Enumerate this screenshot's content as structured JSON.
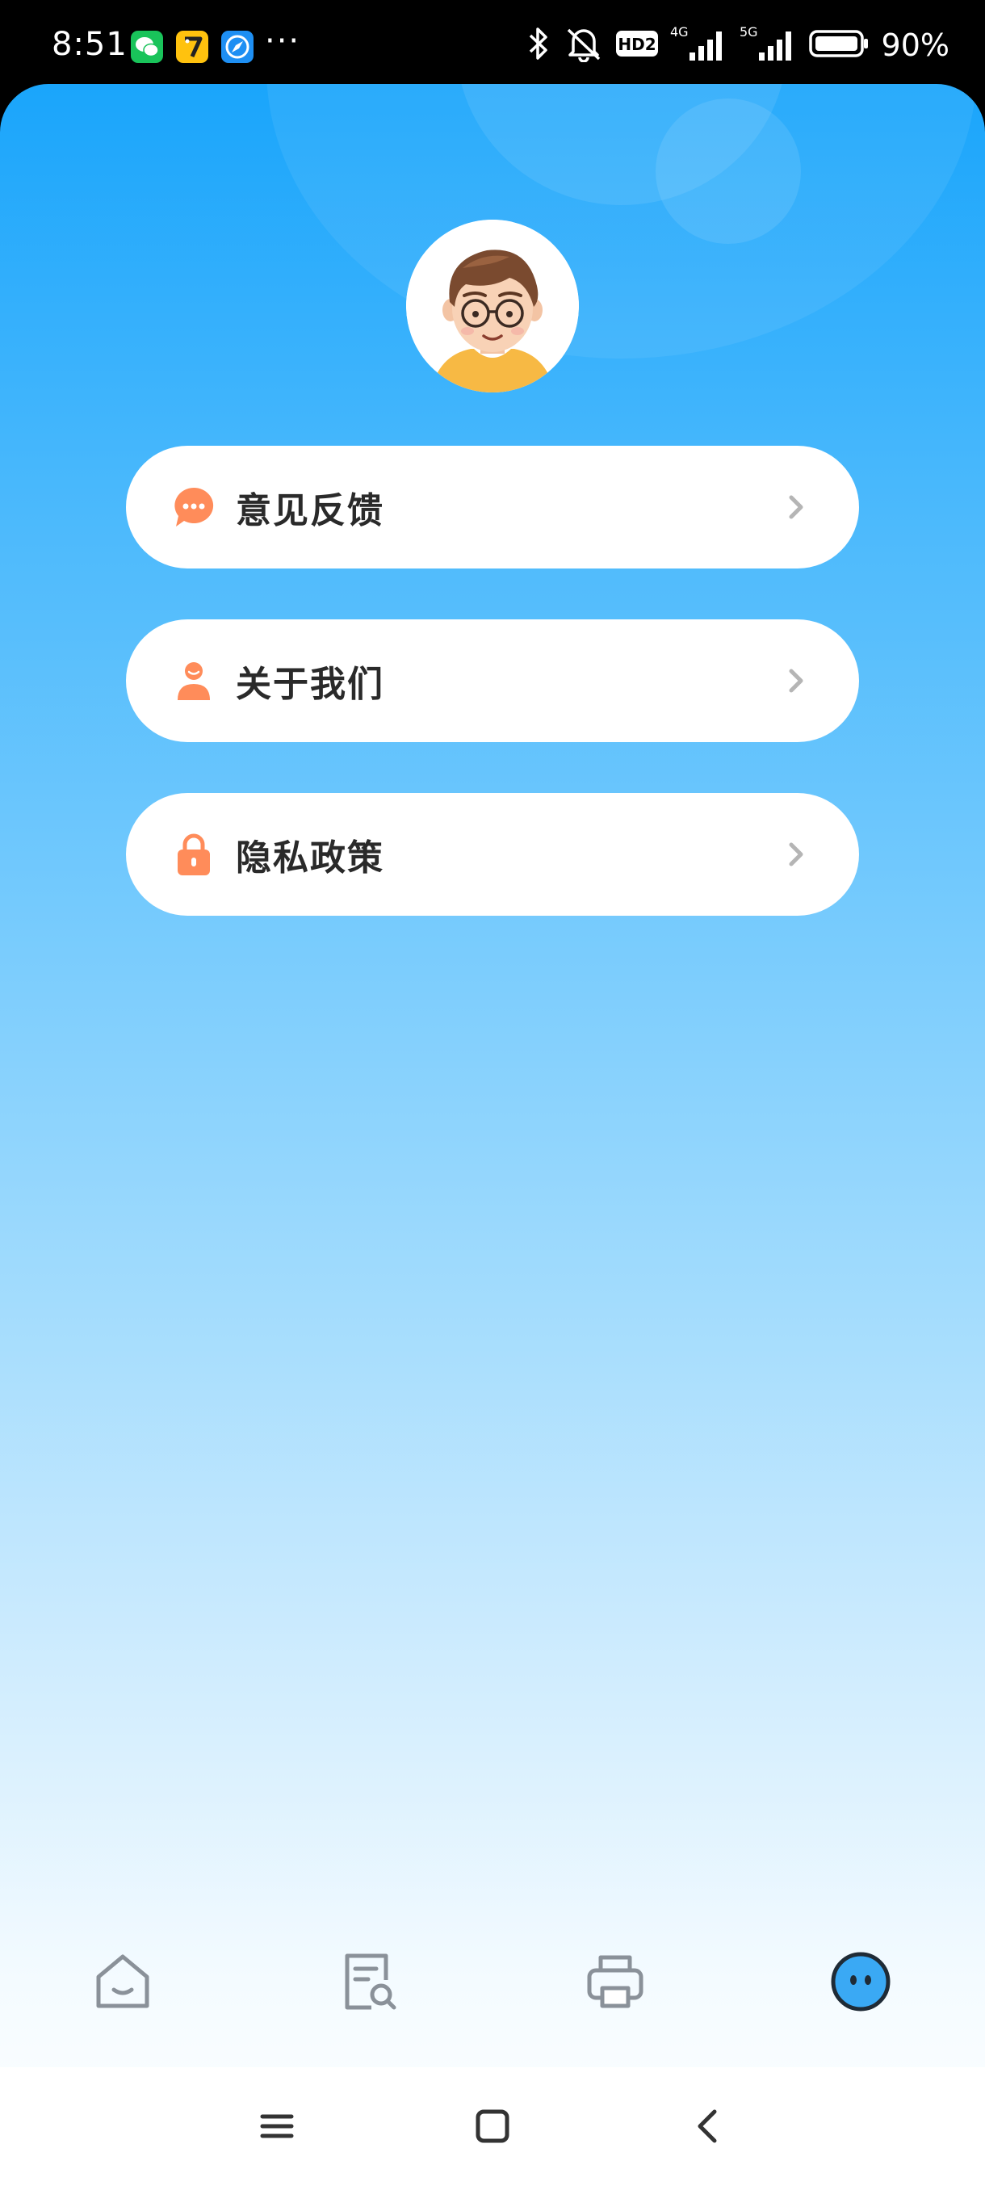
{
  "status_bar": {
    "time": "8:51",
    "more_dots": "···",
    "network_badge": "HD2",
    "signal_1_type": "4G",
    "signal_2_type": "5G",
    "battery": "90%"
  },
  "status_icons": [
    "wechat-icon",
    "seven-app-icon",
    "browser-icon",
    "bluetooth-icon",
    "mute-icon",
    "hd-badge-icon",
    "signal-icon",
    "battery-icon"
  ],
  "menu": {
    "items": [
      {
        "label": "意见反馈",
        "icon": "feedback-icon"
      },
      {
        "label": "关于我们",
        "icon": "about-us-icon"
      },
      {
        "label": "隐私政策",
        "icon": "privacy-lock-icon"
      }
    ]
  },
  "tab_bar": {
    "tabs": [
      {
        "icon": "home-icon"
      },
      {
        "icon": "document-search-icon"
      },
      {
        "icon": "printer-icon"
      },
      {
        "icon": "profile-face-icon",
        "active": true
      }
    ]
  },
  "system_nav": [
    "menu-lines-icon",
    "home-square-icon",
    "back-chevron-icon"
  ],
  "colors": {
    "gradient_top": "#1aa5fb",
    "gradient_bottom": "#ffffff",
    "menu_icon_orange": "#ff8c5a",
    "menu_text": "#2a2a2a",
    "tab_icon": "#8a9199",
    "tab_active_fill": "#3aa9f4"
  }
}
